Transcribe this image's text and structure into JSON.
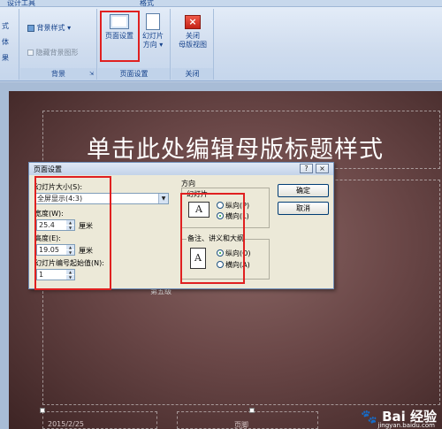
{
  "tabbar": {
    "left": "设计工具",
    "right": "格式"
  },
  "ribbon": {
    "left_partial": [
      "式",
      "体",
      "果"
    ],
    "bg_style": "背景样式",
    "hide_bg": "隐藏背景图形",
    "group_bg": "背景",
    "page_setup": "页面设置",
    "slide_orient_1": "幻灯片",
    "slide_orient_2": "方向",
    "group_page": "页面设置",
    "close_1": "关闭",
    "close_2": "母版视图",
    "group_close": "关闭"
  },
  "slide": {
    "title": "单击此处编辑母版标题样式",
    "sub_partial": "第五级",
    "footer_date": "2015/2/25",
    "footer_mid": "页脚"
  },
  "dialog": {
    "title": "页面设置",
    "help": "?",
    "close": "×",
    "size_label": "幻灯片大小(S):",
    "size_value": "全屏显示(4:3)",
    "width_label": "宽度(W):",
    "width_value": "25.4",
    "width_unit": "厘米",
    "height_label": "高度(E):",
    "height_value": "19.05",
    "height_unit": "厘米",
    "start_label": "幻灯片编号起始值(N):",
    "start_value": "1",
    "orient_label": "方向",
    "slides_label": "幻灯片",
    "slides_portrait": "纵向(P)",
    "slides_landscape": "横向(L)",
    "notes_label": "备注、讲义和大纲",
    "notes_portrait": "纵向(O)",
    "notes_landscape": "横向(A)",
    "ok": "确定",
    "cancel": "取消"
  },
  "watermark": {
    "brand": "Bai 经验",
    "url": "jingyan.baidu.com"
  }
}
